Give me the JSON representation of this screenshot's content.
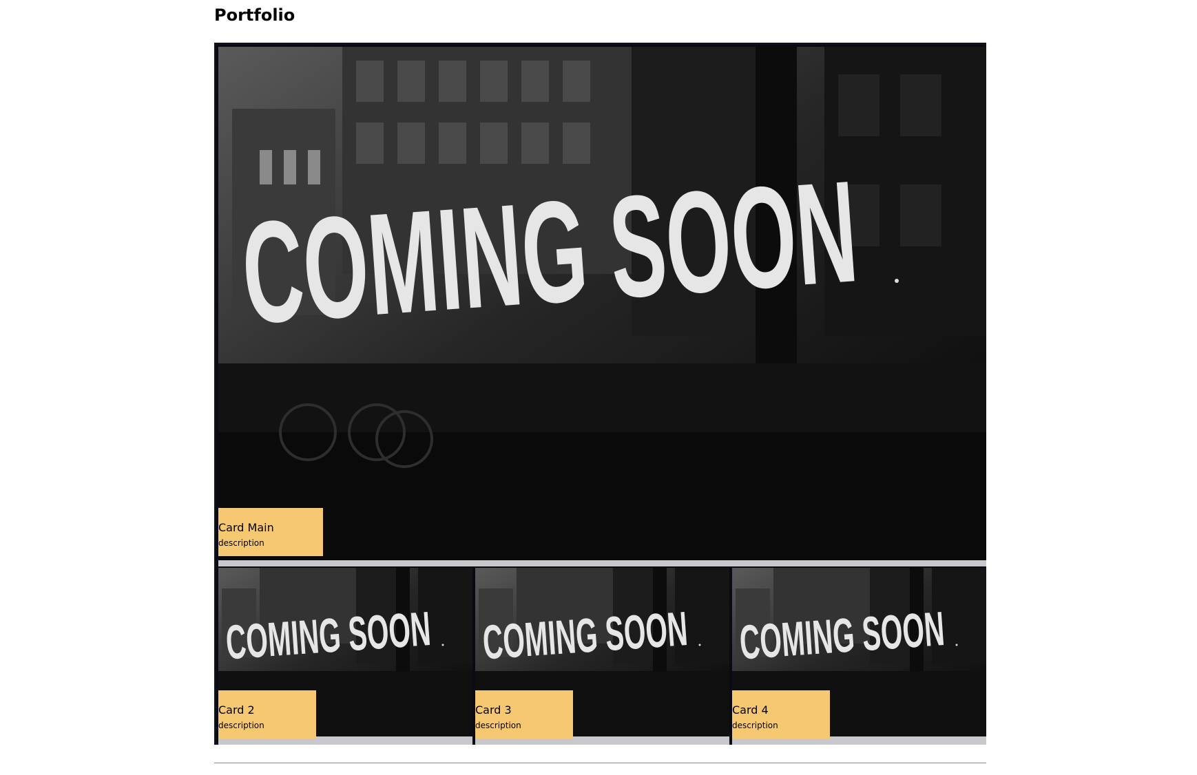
{
  "page": {
    "title": "Portfolio"
  },
  "cards": {
    "main": {
      "title": "Card Main",
      "description": "description",
      "image_text": "COMING SOON"
    },
    "card2": {
      "title": "Card 2",
      "description": "description",
      "image_text": "COMING SOON"
    },
    "card3": {
      "title": "Card 3",
      "description": "description",
      "image_text": "COMING SOON"
    },
    "card4": {
      "title": "Card 4",
      "description": "description",
      "image_text": "COMING SOON"
    }
  },
  "colors": {
    "label_background": "#f7c872",
    "grid_border": "#101018",
    "image_bar": "#c8c8cc",
    "divider": "#888888"
  },
  "icons": {
    "card_photo": "coming-soon-photo"
  }
}
